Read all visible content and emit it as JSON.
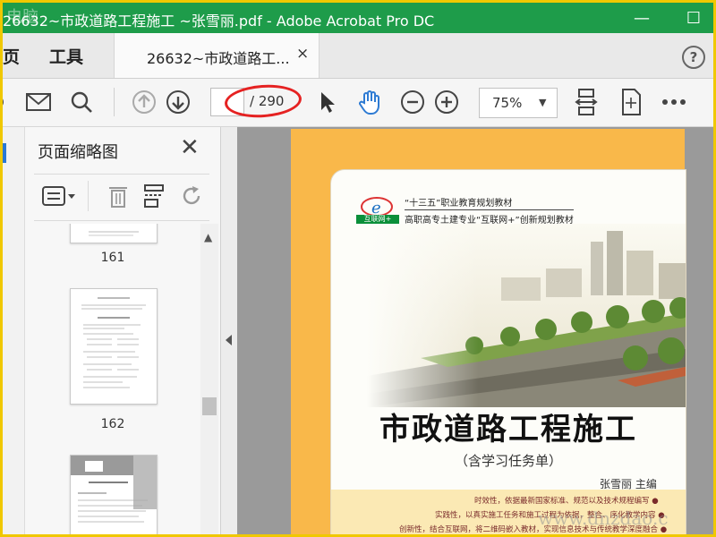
{
  "window": {
    "title": "26632~市政道路工程施工 ~张雪丽.pdf - Adobe Acrobat Pro DC",
    "watermark": "电脑",
    "minimize": "—",
    "maximize": "☐"
  },
  "tabs": {
    "home": "页",
    "tools": "工具",
    "document": "26632~市政道路工...",
    "close": "×",
    "help": "?"
  },
  "toolbar": {
    "page_current": "",
    "page_total": "/ 290",
    "zoom": "75%"
  },
  "panel": {
    "title": "页面缩略图",
    "thumbnails": [
      {
        "page": "161"
      },
      {
        "page": "162"
      }
    ]
  },
  "cover": {
    "series_line1": "“十三五”职业教育规划教材",
    "series_line2": "高职高专土建专业“互联网+”创新规划教材",
    "logo_tag": "互联网+",
    "title": "市政道路工程施工",
    "subtitle": "（含学习任务单）",
    "author": "张雪丽 主编",
    "blurb1": "时效性，依据最新国家标准、规范以及技术规程编写 ●",
    "blurb2": "实践性，以真实施工任务和施工过程为依据，整合、序化教学内容 ●",
    "blurb3": "创新性，结合互联网，将二维码嵌入教材，实现信息技术与传统教学深度融合 ●"
  },
  "site_watermark": "www.dnzdao.c",
  "colors": {
    "titlebar": "#1e9c4a",
    "highlight_oval": "#e52222",
    "cover_background": "#f9b84a"
  }
}
